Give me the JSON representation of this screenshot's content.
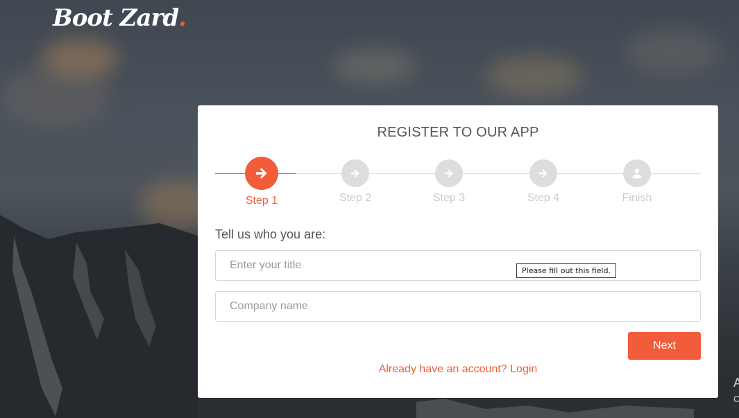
{
  "logo": {
    "text": "Boot Zard",
    "dot": "."
  },
  "form": {
    "title": "REGISTER TO OUR APP",
    "section_label": "Tell us who you are:",
    "title_field": {
      "placeholder": "Enter your title",
      "value": ""
    },
    "company_field": {
      "placeholder": "Company name",
      "value": ""
    },
    "validation_tooltip": "Please fill out this field.",
    "next_label": "Next",
    "login_link": "Already have an account? Login"
  },
  "wizard": {
    "active_step": 1,
    "steps": [
      {
        "label": "Step 1",
        "icon": "arrow-right-icon",
        "state": "active"
      },
      {
        "label": "Step 2",
        "icon": "arrow-right-icon",
        "state": "inactive"
      },
      {
        "label": "Step 3",
        "icon": "arrow-right-icon",
        "state": "inactive"
      },
      {
        "label": "Step 4",
        "icon": "arrow-right-icon",
        "state": "inactive"
      },
      {
        "label": "Finish",
        "icon": "user-icon",
        "state": "inactive"
      }
    ]
  },
  "edge_text": {
    "line1": "A",
    "line2": "C"
  },
  "colors": {
    "accent": "#f25c3a",
    "inactive": "#dddddd",
    "text": "#555555"
  }
}
